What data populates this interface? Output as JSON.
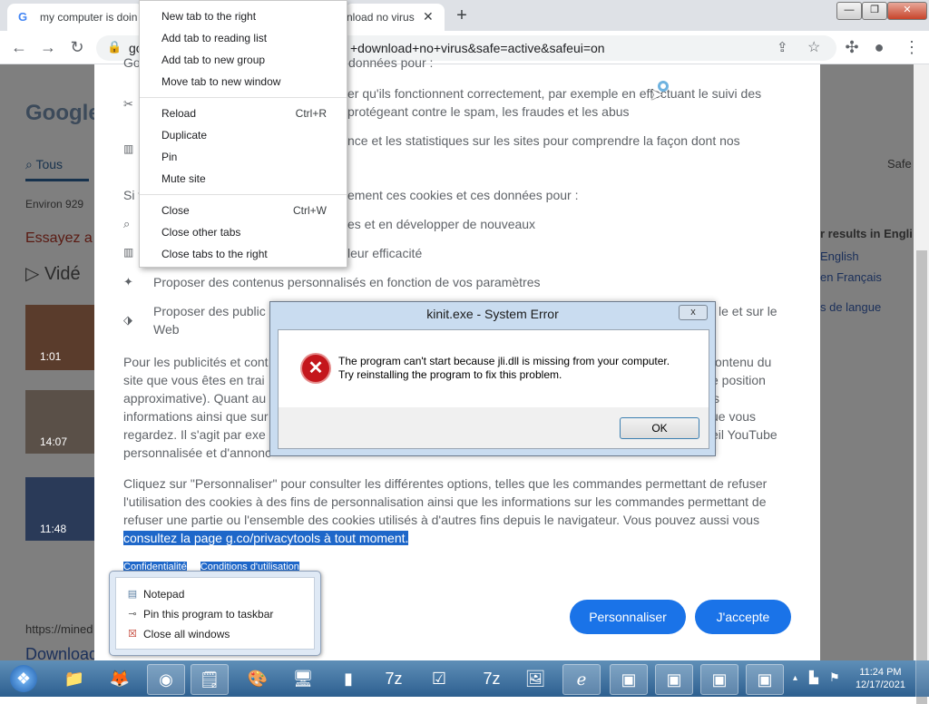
{
  "browser": {
    "tabs": [
      {
        "title": "my computer is doin"
      },
      {
        "title": "nload no virus"
      }
    ],
    "new_tab_label": "+",
    "url": "+download+no+virus&safe=active&safeui=on",
    "url_prefix": "go"
  },
  "context_menu": {
    "groups": [
      [
        {
          "label": "New tab to the right"
        },
        {
          "label": "Add tab to reading list"
        },
        {
          "label": "Add tab to new group"
        },
        {
          "label": "Move tab to new window"
        }
      ],
      [
        {
          "label": "Reload",
          "shortcut": "Ctrl+R"
        },
        {
          "label": "Duplicate"
        },
        {
          "label": "Pin"
        },
        {
          "label": "Mute site"
        }
      ],
      [
        {
          "label": "Close",
          "shortcut": "Ctrl+W"
        },
        {
          "label": "Close other tabs"
        },
        {
          "label": "Close tabs to the right"
        }
      ]
    ]
  },
  "google_page": {
    "logo": "Google",
    "tab_all": "Tous",
    "results_count": "Environ 929",
    "try_text": "Essayez a",
    "videos_label": "Vidé",
    "video_times": [
      "1:01",
      "14:07",
      "11:48"
    ],
    "safe_label": "Safe",
    "side_results_title": "r results in Engli",
    "side_english": "English",
    "side_french": "en Français",
    "side_lang": "s de langue",
    "bottom_url": "https://mined",
    "bottom_download": "Download"
  },
  "consent": {
    "lines": [
      {
        "text": "Go",
        "partial": true
      },
      {
        "text": "données pour :"
      },
      {
        "text": "er qu'ils fonctionnent correctement, par exemple en effectuant le suivi des"
      },
      {
        "text": "protégeant contre le spam, les fraudes et les abus"
      },
      {
        "text": "nce et les statistiques sur les sites pour comprendre la façon dont nos"
      },
      {
        "text": "ement ces cookies et ces données pour :"
      },
      {
        "text": "es et en développer de nouveaux"
      },
      {
        "text": "leur efficacité"
      },
      {
        "text": "Proposer des contenus personnalisés en fonction de vos paramètres"
      },
      {
        "text": "Proposer des public"
      },
      {
        "text": "le et sur le"
      },
      {
        "text": "Web"
      }
    ],
    "para2_lines": [
      {
        "left": "Pour les publicités et cont",
        "right": "contenu du"
      },
      {
        "left": "site que vous êtes en trai",
        "right": "e position"
      },
      {
        "left": "approximative). Quant au",
        "right": "s"
      },
      {
        "left": "informations ainsi que sur",
        "right": "ue vous"
      },
      {
        "left": "regardez. Il s'agit par exe",
        "right": "eil YouTube"
      },
      {
        "left": "personnalisée et d'annonc",
        "right": ""
      }
    ],
    "para3": [
      "Cliquez sur \"Personnaliser\" pour consulter les différentes options, telles que les commandes permettant de refuser",
      "l'utilisation des cookies à des fins de personnalisation ainsi que les informations sur les commandes permettant de",
      "refuser une partie ou l'ensemble des cookies utilisés à d'autres fins depuis le navigateur. Vous pouvez aussi vous"
    ],
    "highlight_line": "consultez la page g.co/privacytools à tout moment.",
    "privacy_link": "Confidentialité",
    "terms_link": "Conditions d'utilisation",
    "customize_button": "Personnaliser",
    "accept_button": "J'accepte"
  },
  "error_dialog": {
    "title": "kinit.exe - System Error",
    "close_label": "x",
    "message_line1": "The program can't start because jli.dll is missing from your computer.",
    "message_line2": "Try reinstalling the program to fix this problem.",
    "ok_label": "OK"
  },
  "jump_list": {
    "items": [
      {
        "label": "Notepad",
        "icon": "notepad-icon"
      },
      {
        "label": "Pin this program to taskbar",
        "icon": "pin-icon"
      },
      {
        "label": "Close all windows",
        "icon": "close-windows-icon"
      }
    ]
  },
  "taskbar": {
    "clock_time": "11:24 PM",
    "clock_date": "12/17/2021",
    "icons": [
      "start-orb",
      "folder-icon",
      "firefox-icon",
      "chrome-icon",
      "notepad-icon",
      "paint-icon",
      "control-panel-icon",
      "server-icon",
      "7z-manager-icon",
      "checklist-icon",
      "7z-icon",
      "photos-icon",
      "ie-icon",
      "window-icon",
      "window-icon",
      "window-icon",
      "window-icon"
    ]
  },
  "colors": {
    "accent_blue": "#1a73e8",
    "error_red": "#c4161c",
    "highlight_blue": "#1e67c9"
  }
}
